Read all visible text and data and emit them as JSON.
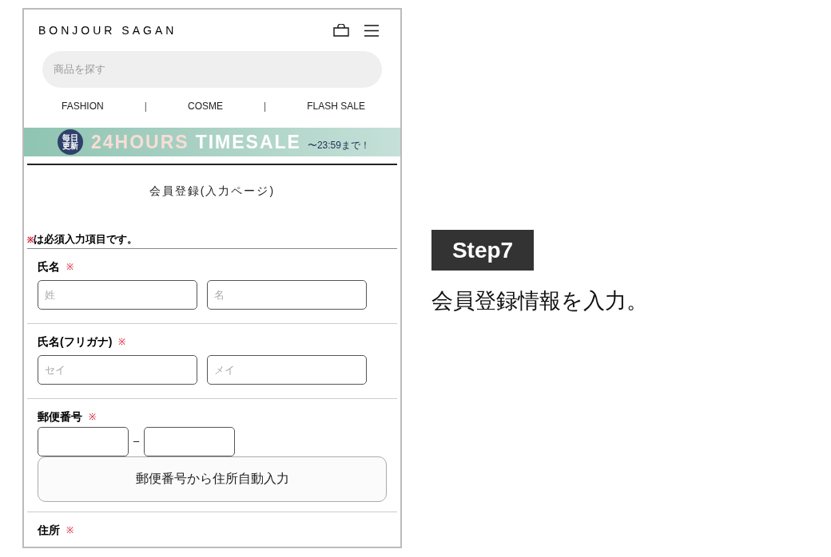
{
  "brand": "BONJOUR SAGAN",
  "search": {
    "placeholder": "商品を探す"
  },
  "nav": [
    {
      "kind": "link",
      "label": "FASHION"
    },
    {
      "kind": "separator",
      "label": "|"
    },
    {
      "kind": "link",
      "label": "COSME"
    },
    {
      "kind": "separator",
      "label": "|"
    },
    {
      "kind": "link",
      "label": "FLASH SALE"
    }
  ],
  "banner": {
    "badge": [
      "毎日",
      "更新"
    ],
    "headline_1": "24HOURS",
    "headline_2": "TIMESALE",
    "until": "〜23:59まで！"
  },
  "page_title": "会員登録(入力ページ)",
  "required_note": {
    "mark": "※",
    "text": "は必須入力項目です。"
  },
  "sections": [
    {
      "kind": "pair",
      "label": "氏名",
      "mark": "※",
      "inputs": [
        {
          "placeholder": "姓"
        },
        {
          "placeholder": "名"
        }
      ]
    },
    {
      "kind": "pair",
      "label": "氏名(フリガナ)",
      "mark": "※",
      "inputs": [
        {
          "placeholder": "セイ"
        },
        {
          "placeholder": "メイ"
        }
      ]
    },
    {
      "kind": "postal",
      "label": "郵便番号",
      "mark": "※",
      "dash": "–",
      "button": "郵便番号から住所自動入力"
    },
    {
      "kind": "label",
      "label": "住所",
      "mark": "※"
    }
  ],
  "step": {
    "badge": "Step7",
    "caption": "会員登録情報を入力。"
  }
}
